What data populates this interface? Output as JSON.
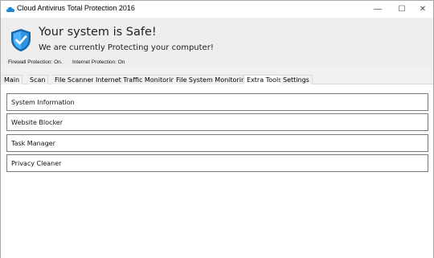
{
  "window": {
    "title": "Cloud Antivirus Total Protection 2016",
    "controls": {
      "minimize": "—",
      "maximize": "☐",
      "close": "✕"
    }
  },
  "status": {
    "title": "Your system is Safe!",
    "subtitle": "We are currently Protecting your computer!",
    "firewall": "Firewall Protection: On.",
    "internet": "Internet Protection: On"
  },
  "tabs": [
    {
      "label": "Main"
    },
    {
      "label": "Scan"
    },
    {
      "label": "File Scanner"
    },
    {
      "label": "Internet Traffic Monitoring"
    },
    {
      "label": "File System Monitoring"
    },
    {
      "label": "Extra Tools",
      "active": true
    },
    {
      "label": "Settings"
    }
  ],
  "tools": [
    {
      "label": "System Information"
    },
    {
      "label": "Website Blocker"
    },
    {
      "label": "Task Manager"
    },
    {
      "label": "Privacy Cleaner"
    }
  ],
  "colors": {
    "accent": "#1e88d6",
    "shield_dark": "#1565a8",
    "shield_light": "#4fb3ff"
  }
}
